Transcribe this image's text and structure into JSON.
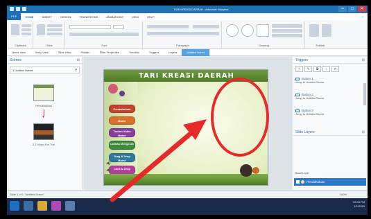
{
  "window": {
    "title": "TARI KREASI DAERAH - Articulate Storyline",
    "controls": [
      "–",
      "□",
      "✕"
    ]
  },
  "menu": {
    "items": [
      "FILE",
      "HOME",
      "INSERT",
      "DESIGN",
      "TRANSITIONS",
      "ANIMATIONS",
      "VIEW",
      "HELP"
    ]
  },
  "ribbon": {
    "groups": [
      "Clipboard",
      "Slide",
      "Font",
      "Paragraph",
      "Drawing",
      "Publish"
    ]
  },
  "view_tabs": [
    "Home view",
    "Story View",
    "Slide View",
    "Publish",
    "Slide Properties",
    "Timeline",
    "Triggers",
    "Layers",
    "Untitled Scene"
  ],
  "scenes_panel": {
    "title": "Scenes",
    "selected_scene": "1 Untitled Scene",
    "thumb_labels": [
      "Pendahuluan",
      "2.2 Video For The"
    ]
  },
  "slide": {
    "title": "TARI KREASI DAERAH",
    "menu_buttons": [
      "Pendahuluan",
      "Materi",
      "Tonton Video Materi",
      "Latihan Mengecek",
      "Drag & Drop Materi",
      "Click & Drop"
    ]
  },
  "triggers_panel": {
    "title": "Triggers",
    "items": [
      {
        "name": "Button 1",
        "desc": "Jump to Untitled Scene"
      },
      {
        "name": "Button 2",
        "desc": "Jump to Untitled Scene"
      },
      {
        "name": "Button 3",
        "desc": "Jump to Untitled Scene"
      }
    ]
  },
  "layers_panel": {
    "title": "Slide Layers",
    "base_label": "Base Layer",
    "layer_name": "Pendahuluan"
  },
  "status": {
    "slide_info": "Slide 1 of 1   \"Untitled Scene\"",
    "zoom": "100%"
  },
  "taskbar": {
    "time": "12:00 PM",
    "date": "1/1/2020"
  },
  "colors": {
    "accent": "#1f6fb3",
    "annotation": "#e62a2a"
  }
}
